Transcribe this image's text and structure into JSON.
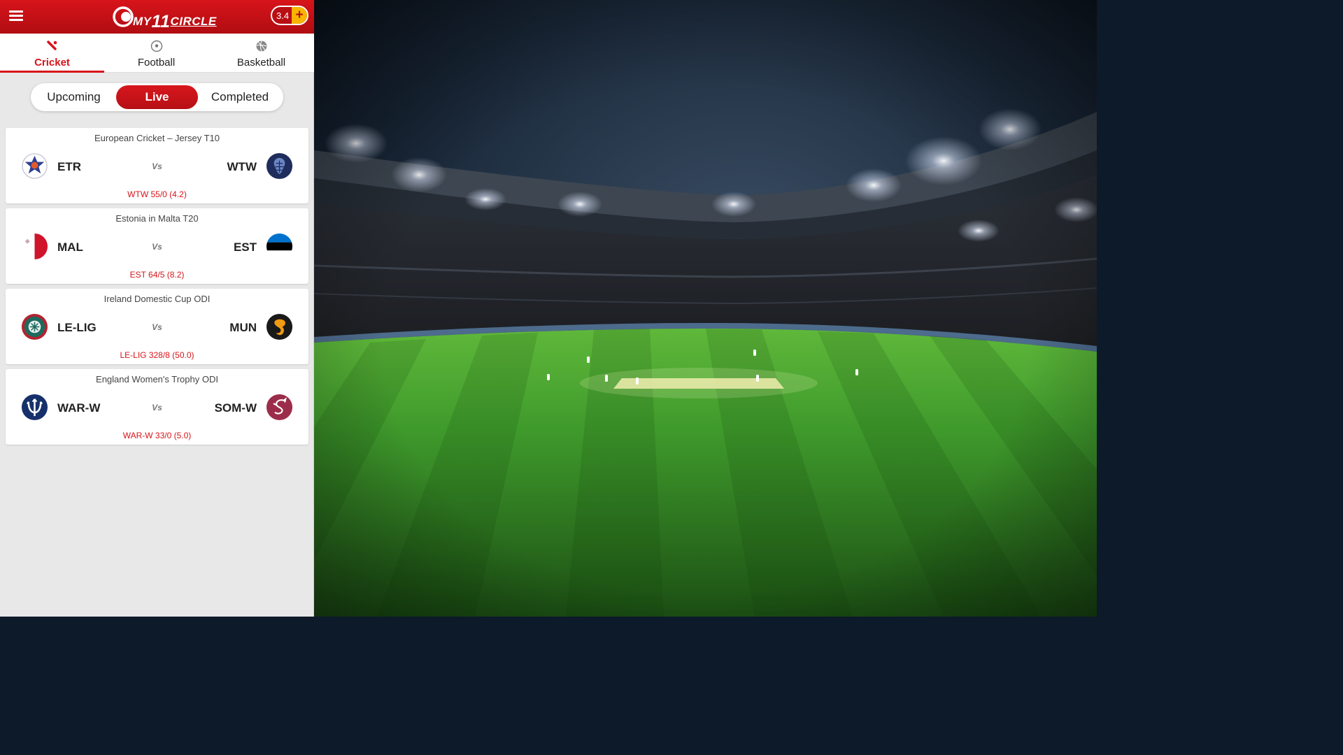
{
  "app": {
    "brand_lead": "my",
    "brand_number": "11",
    "brand_tail": "circle",
    "wallet_amount": "3.4",
    "wallet_add_symbol": "+"
  },
  "sport_tabs": [
    {
      "label": "Cricket",
      "active": true
    },
    {
      "label": "Football",
      "active": false
    },
    {
      "label": "Basketball",
      "active": false
    }
  ],
  "status_tabs": [
    {
      "label": "Upcoming",
      "active": false
    },
    {
      "label": "Live",
      "active": true
    },
    {
      "label": "Completed",
      "active": false
    }
  ],
  "matches": [
    {
      "league": "European Cricket – Jersey T10",
      "team1": "ETR",
      "team2": "WTW",
      "vs": "Vs",
      "score": "WTW 55/0 (4.2)"
    },
    {
      "league": "Estonia in Malta T20",
      "team1": "MAL",
      "team2": "EST",
      "vs": "Vs",
      "score": "EST 64/5 (8.2)"
    },
    {
      "league": "Ireland Domestic Cup ODI",
      "team1": "LE-LIG",
      "team2": "MUN",
      "vs": "Vs",
      "score": "LE-LIG 328/8 (50.0)"
    },
    {
      "league": "England Women's Trophy ODI",
      "team1": "WAR-W",
      "team2": "SOM-W",
      "vs": "Vs",
      "score": "WAR-W 33/0 (5.0)"
    }
  ],
  "colors": {
    "brand_red": "#d7141a",
    "wallet_yellow": "#f7b400",
    "panel_bg": "#e8e8e8",
    "pitch_green": "#3f9a2c"
  }
}
